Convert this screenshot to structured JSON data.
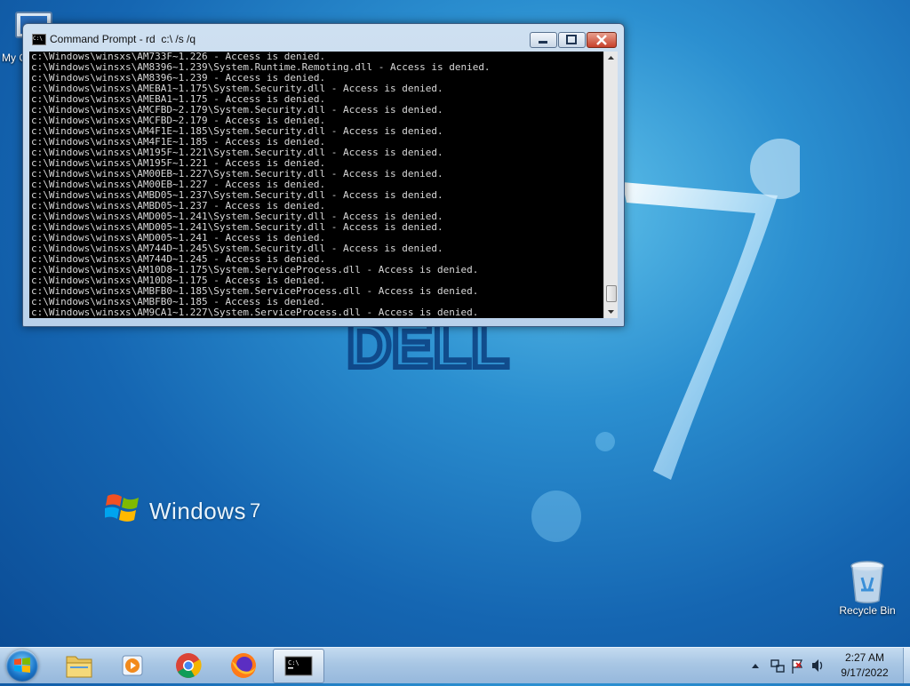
{
  "desktop": {
    "icons": [
      {
        "label": "My C",
        "icon": "computer-icon"
      },
      {
        "label": "Recycle Bin",
        "icon": "recycle-bin-icon"
      }
    ],
    "wallpaper_logo_text": "Windows",
    "wallpaper_logo_version": "7"
  },
  "window": {
    "title": "Command Prompt - rd  c:\\ /s /q",
    "icon": "console-icon",
    "controls": [
      "minimize",
      "maximize",
      "close"
    ],
    "console_lines": [
      "c:\\Windows\\winsxs\\AM733F~1.226 - Access is denied.",
      "c:\\Windows\\winsxs\\AM8396~1.239\\System.Runtime.Remoting.dll - Access is denied.",
      "c:\\Windows\\winsxs\\AM8396~1.239 - Access is denied.",
      "c:\\Windows\\winsxs\\AMEBA1~1.175\\System.Security.dll - Access is denied.",
      "c:\\Windows\\winsxs\\AMEBA1~1.175 - Access is denied.",
      "c:\\Windows\\winsxs\\AMCFBD~2.179\\System.Security.dll - Access is denied.",
      "c:\\Windows\\winsxs\\AMCFBD~2.179 - Access is denied.",
      "c:\\Windows\\winsxs\\AM4F1E~1.185\\System.Security.dll - Access is denied.",
      "c:\\Windows\\winsxs\\AM4F1E~1.185 - Access is denied.",
      "c:\\Windows\\winsxs\\AM195F~1.221\\System.Security.dll - Access is denied.",
      "c:\\Windows\\winsxs\\AM195F~1.221 - Access is denied.",
      "c:\\Windows\\winsxs\\AM00EB~1.227\\System.Security.dll - Access is denied.",
      "c:\\Windows\\winsxs\\AM00EB~1.227 - Access is denied.",
      "c:\\Windows\\winsxs\\AMBD05~1.237\\System.Security.dll - Access is denied.",
      "c:\\Windows\\winsxs\\AMBD05~1.237 - Access is denied.",
      "c:\\Windows\\winsxs\\AMD005~1.241\\System.Security.dll - Access is denied.",
      "c:\\Windows\\winsxs\\AMD005~1.241\\System.Security.dll - Access is denied.",
      "c:\\Windows\\winsxs\\AMD005~1.241 - Access is denied.",
      "c:\\Windows\\winsxs\\AM744D~1.245\\System.Security.dll - Access is denied.",
      "c:\\Windows\\winsxs\\AM744D~1.245 - Access is denied.",
      "c:\\Windows\\winsxs\\AM10D8~1.175\\System.ServiceProcess.dll - Access is denied.",
      "c:\\Windows\\winsxs\\AM10D8~1.175 - Access is denied.",
      "c:\\Windows\\winsxs\\AMBFB0~1.185\\System.ServiceProcess.dll - Access is denied.",
      "c:\\Windows\\winsxs\\AMBFB0~1.185 - Access is denied.",
      "c:\\Windows\\winsxs\\AM9CA1~1.227\\System.ServiceProcess.dll - Access is denied."
    ]
  },
  "taskbar": {
    "pinned": [
      {
        "name": "windows-explorer",
        "icon": "folder-icon"
      },
      {
        "name": "media-player",
        "icon": "media-player-icon"
      },
      {
        "name": "chrome",
        "icon": "chrome-icon"
      },
      {
        "name": "firefox",
        "icon": "firefox-icon"
      },
      {
        "name": "command-prompt",
        "icon": "cmd-icon",
        "active": true
      }
    ],
    "tray_icons": [
      "show-hidden-icons-arrow",
      "network-icon",
      "action-center-flag-icon",
      "volume-icon"
    ],
    "clock": {
      "time": "2:27 AM",
      "date": "9/17/2022"
    }
  }
}
